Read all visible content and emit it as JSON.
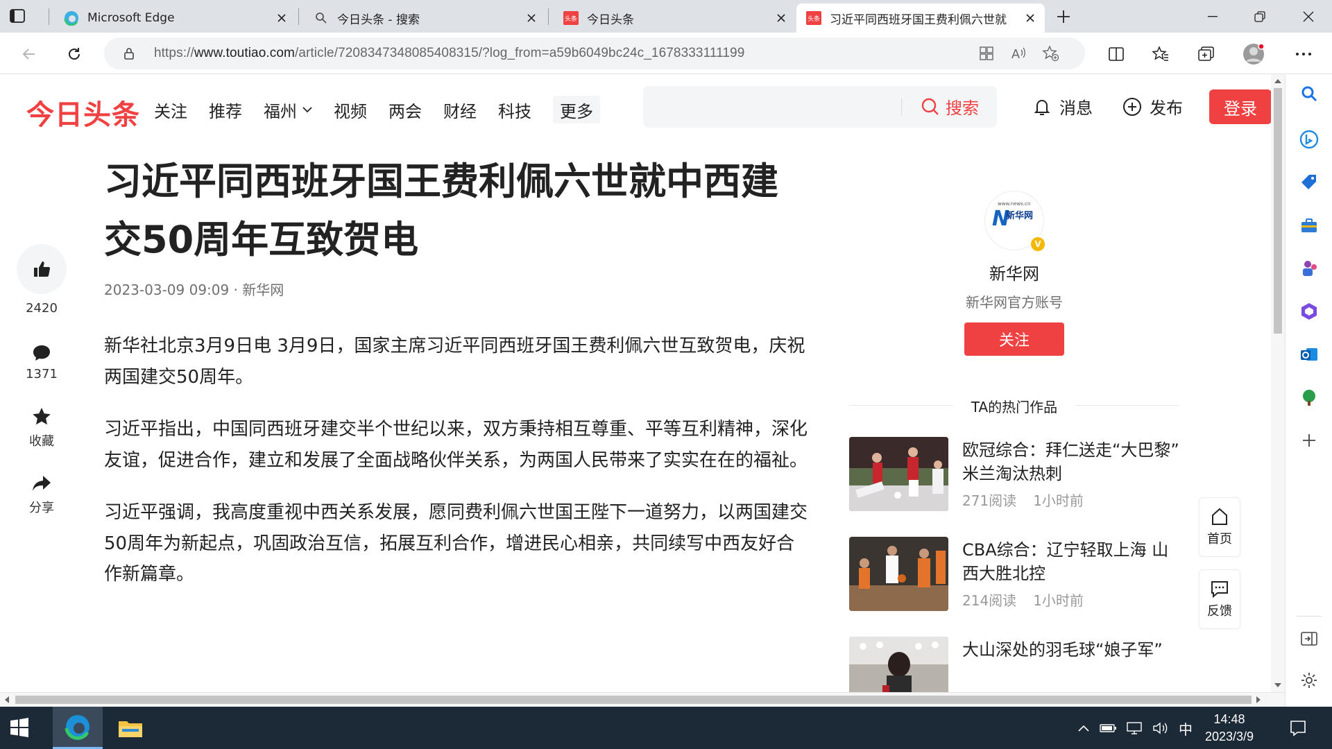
{
  "browser": {
    "tabs": [
      {
        "title": "Microsoft Edge",
        "favicon": "edge-icon",
        "active": false
      },
      {
        "title": "今日头条 - 搜索",
        "favicon": "search-icon",
        "active": false
      },
      {
        "title": "今日头条",
        "favicon": "toutiao-icon",
        "active": false
      },
      {
        "title": "习近平同西班牙国王费利佩六世就",
        "favicon": "toutiao-icon",
        "active": true
      }
    ],
    "toutiao_favicon_text": "头条",
    "url_prefix": "https://",
    "url_domain": "www.toutiao.com",
    "url_path": "/article/7208347348085408315/?log_from=a59b6049bc24c_1678333111199"
  },
  "site": {
    "logo": "今日头条",
    "nav": [
      "关注",
      "推荐",
      "福州",
      "视频",
      "两会",
      "财经",
      "科技"
    ],
    "nav_more": "更多",
    "search_button": "搜索",
    "messages": "消息",
    "publish": "发布",
    "login": "登录"
  },
  "rail": {
    "likes": "2420",
    "comments": "1371",
    "collect": "收藏",
    "share": "分享"
  },
  "article": {
    "title": "习近平同西班牙国王费利佩六世就中西建交50周年互致贺电",
    "meta": "2023-03-09 09:09 · 新华网",
    "paragraphs": [
      "新华社北京3月9日电 3月9日，国家主席习近平同西班牙国王费利佩六世互致贺电，庆祝两国建交50周年。",
      "习近平指出，中国同西班牙建交半个世纪以来，双方秉持相互尊重、平等互利精神，深化友谊，促进合作，建立和发展了全面战略伙伴关系，为两国人民带来了实实在在的福祉。",
      "习近平强调，我高度重视中西关系发展，愿同费利佩六世国王陛下一道努力，以两国建交50周年为新起点，巩固政治互信，拓展互利合作，增进民心相亲，共同续写中西友好合作新篇章。"
    ]
  },
  "author": {
    "logo_top": "www.news.cn",
    "logo_text": "新华网",
    "name": "新华网",
    "desc": "新华网官方账号",
    "follow": "关注",
    "hot_heading": "TA的热门作品",
    "hot": [
      {
        "title": "欧冠综合：拜仁送走“大巴黎” 米兰淘汰热刺",
        "reads": "271阅读",
        "time": "1小时前"
      },
      {
        "title": "CBA综合：辽宁轻取上海 山西大胜北控",
        "reads": "214阅读",
        "time": "1小时前"
      },
      {
        "title": "大山深处的羽毛球“娘子军”",
        "reads": "",
        "time": ""
      }
    ]
  },
  "float": {
    "home": "首页",
    "feedback": "反馈"
  },
  "taskbar": {
    "ime": "中",
    "time": "14:48",
    "date": "2023/3/9"
  },
  "colors": {
    "brand": "#f04142",
    "taskbar": "#1c2a37"
  }
}
